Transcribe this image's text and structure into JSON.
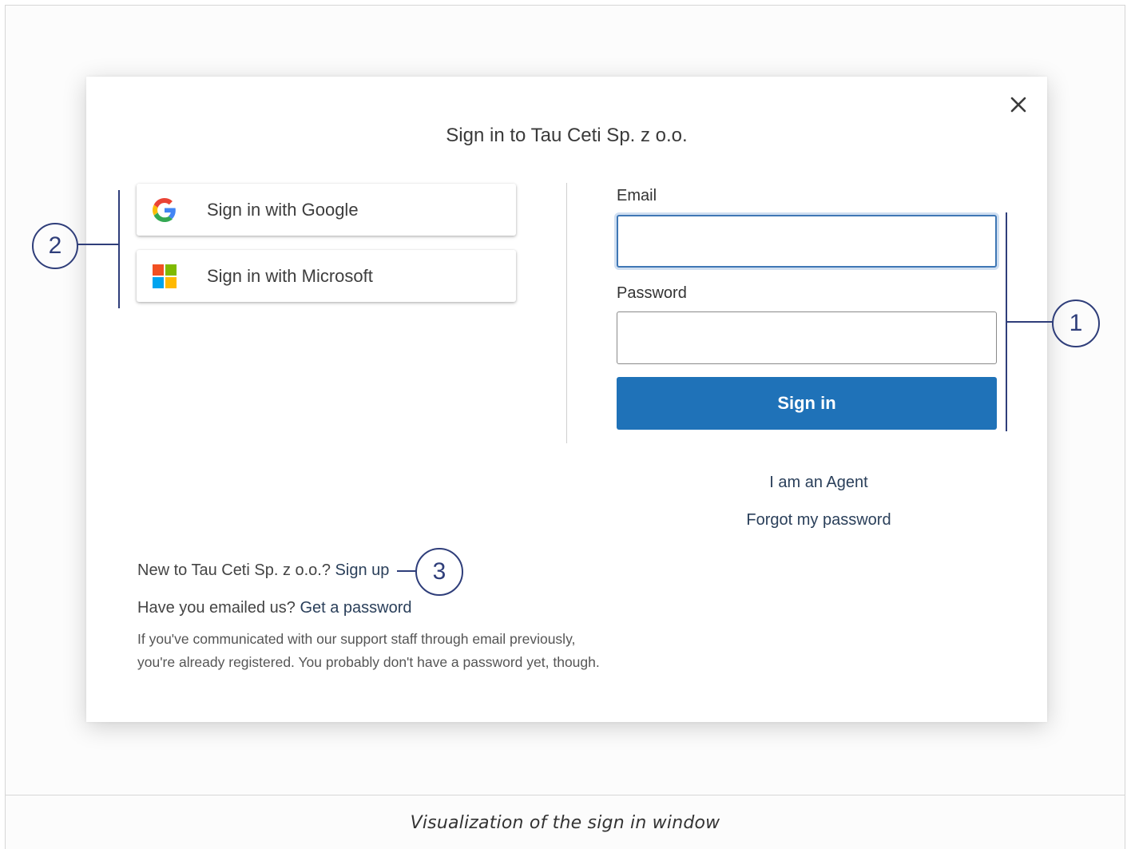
{
  "modal": {
    "title": "Sign in to Tau Ceti Sp. z o.o.",
    "close_icon": "close-icon"
  },
  "sso": {
    "google_label": "Sign in with Google",
    "google_icon": "google-icon",
    "microsoft_label": "Sign in with Microsoft",
    "microsoft_icon": "microsoft-icon"
  },
  "form": {
    "email_label": "Email",
    "email_value": "",
    "password_label": "Password",
    "password_value": "",
    "submit_label": "Sign in"
  },
  "links": {
    "agent": "I am an Agent",
    "forgot": "Forgot my password"
  },
  "footer": {
    "new_prefix": "New to Tau Ceti Sp. z o.o.? ",
    "signup_link": "Sign up",
    "emailed_prefix": "Have you emailed us? ",
    "get_password_link": "Get a password",
    "helper_line1": "If you've communicated with our support staff through email previously,",
    "helper_line2": "you're already registered. You probably don't have a password yet, though."
  },
  "callouts": {
    "one": "1",
    "two": "2",
    "three": "3"
  },
  "caption": "Visualization of the sign in window",
  "colors": {
    "primary_button": "#1f72b8",
    "callout": "#2f3e7a",
    "focus_border": "#3f77b5"
  }
}
